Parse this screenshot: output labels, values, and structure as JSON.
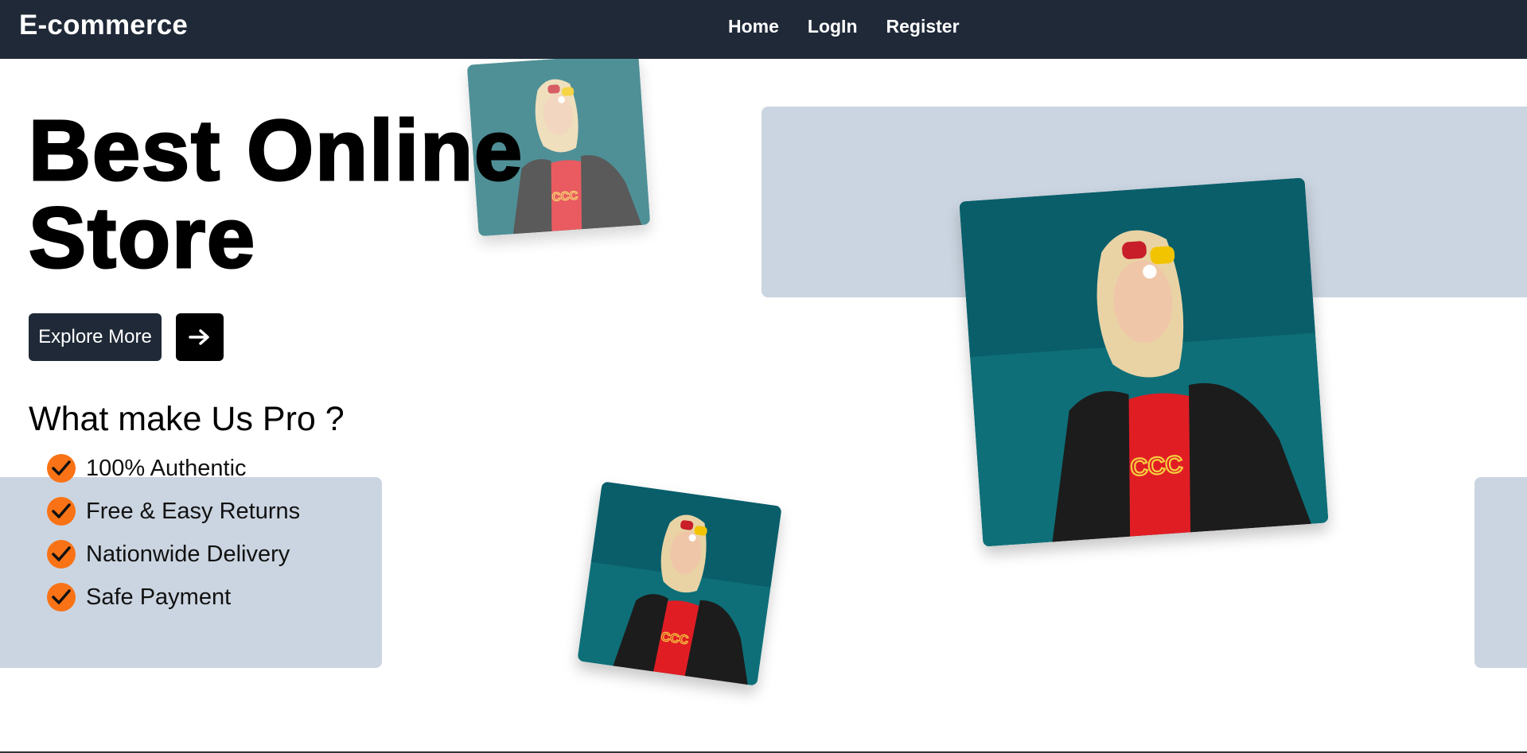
{
  "navbar": {
    "brand": "E-commerce",
    "links": [
      {
        "label": "Home"
      },
      {
        "label": "LogIn"
      },
      {
        "label": "Register"
      }
    ]
  },
  "hero": {
    "title_line1": "Best Online",
    "title_line2": "Store",
    "explore_button": "Explore More",
    "arrow_icon": "arrow-right-icon"
  },
  "features": {
    "heading": "What make Us Pro ?",
    "items": [
      {
        "label": "100% Authentic",
        "icon": "check-circle-icon"
      },
      {
        "label": "Free & Easy Returns",
        "icon": "check-circle-icon"
      },
      {
        "label": "Nationwide Delivery",
        "icon": "check-circle-icon"
      },
      {
        "label": "Safe Payment",
        "icon": "check-circle-icon"
      }
    ]
  },
  "colors": {
    "navbar_bg": "#1f2937",
    "panel_bg": "#cbd5e1",
    "check_accent": "#f97316",
    "photo_bg": "#0e6f78",
    "shirt_red": "#e11d24"
  }
}
